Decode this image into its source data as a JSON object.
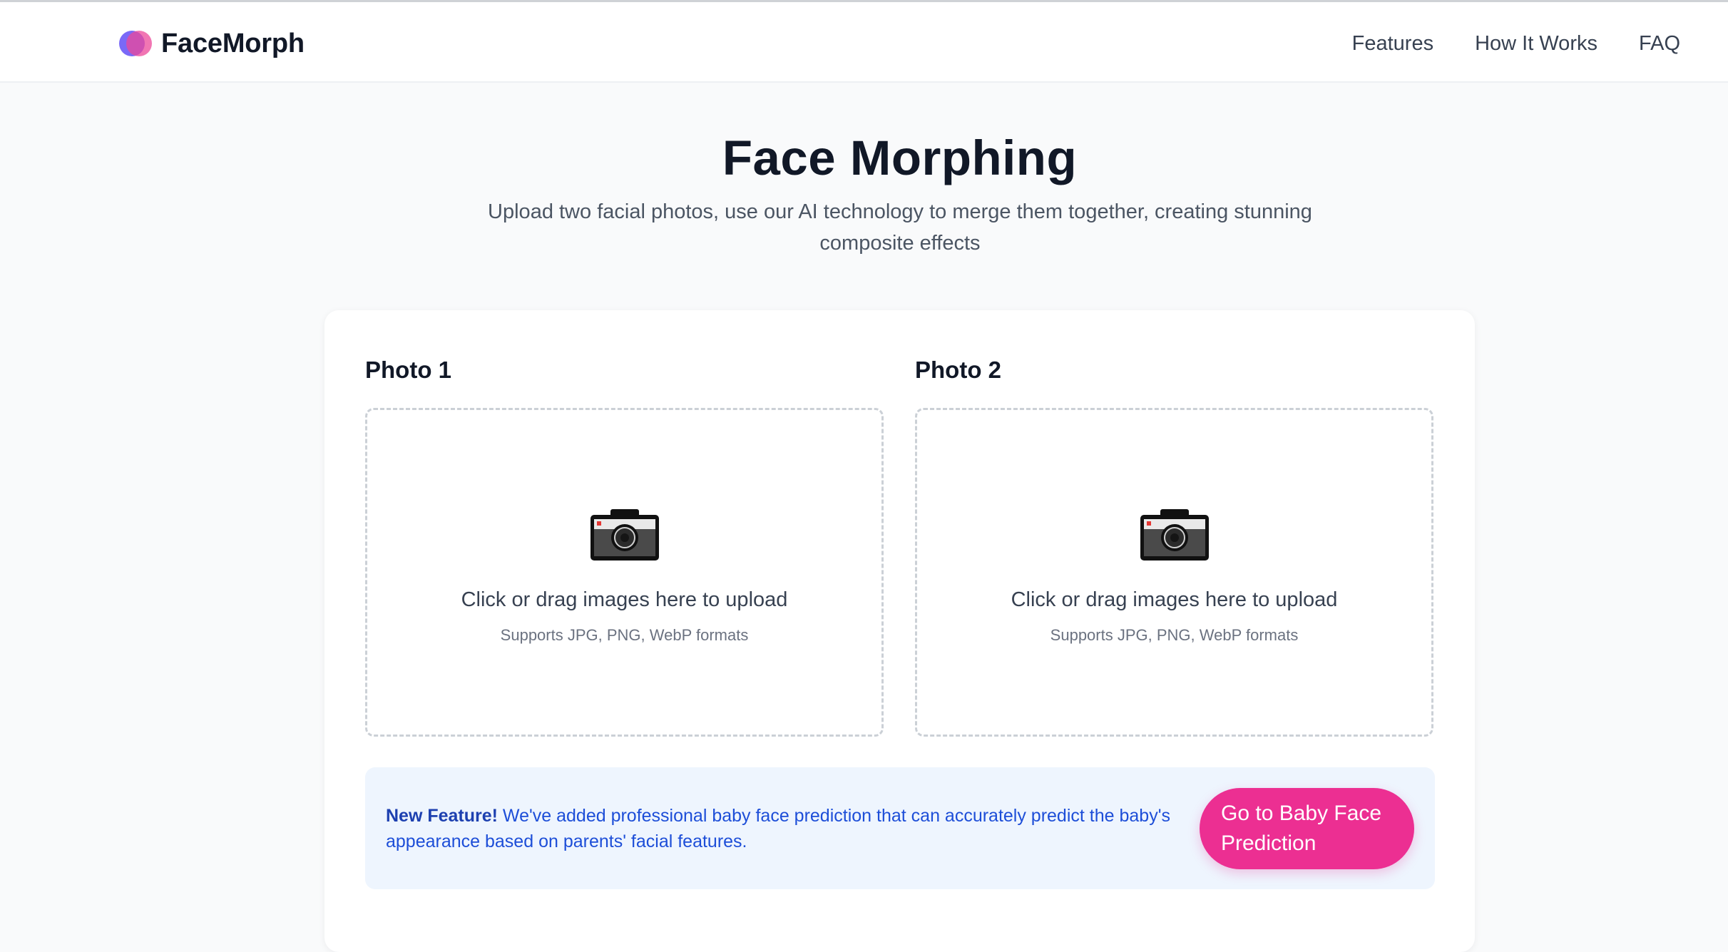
{
  "header": {
    "brand": "FaceMorph",
    "nav": [
      "Features",
      "How It Works",
      "FAQ"
    ]
  },
  "hero": {
    "title": "Face Morphing",
    "subtitle": "Upload two facial photos, use our AI technology to merge them together, creating stunning composite effects"
  },
  "uploads": [
    {
      "label": "Photo 1",
      "prompt": "Click or drag images here to upload",
      "hint": "Supports JPG, PNG, WebP formats",
      "icon": "camera-icon"
    },
    {
      "label": "Photo 2",
      "prompt": "Click or drag images here to upload",
      "hint": "Supports JPG, PNG, WebP formats",
      "icon": "camera-icon"
    }
  ],
  "banner": {
    "badge": "New Feature!",
    "text": " We've added professional baby face prediction that can accurately predict the baby's appearance based on parents' facial features.",
    "button": "Go to Baby Face Prediction"
  },
  "colors": {
    "accent": "#ec2f92",
    "banner_bg": "#eef5fe",
    "banner_text": "#1d4ed8",
    "logo_purple": "#6f5cf6",
    "logo_pink": "#ec4899"
  }
}
